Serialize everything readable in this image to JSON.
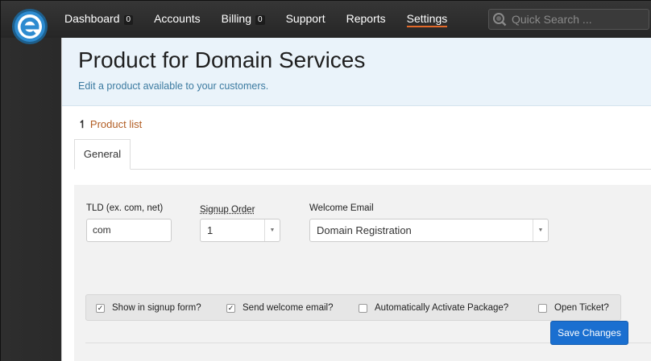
{
  "nav": {
    "items": [
      {
        "label": "Dashboard",
        "badge": "0"
      },
      {
        "label": "Accounts",
        "badge": null
      },
      {
        "label": "Billing",
        "badge": "0"
      },
      {
        "label": "Support",
        "badge": null
      },
      {
        "label": "Reports",
        "badge": null
      },
      {
        "label": "Settings",
        "badge": null,
        "active": true
      }
    ],
    "search_placeholder": "Quick Search ..."
  },
  "header": {
    "title": "Product for Domain Services",
    "subtitle": "Edit a product available to your customers."
  },
  "breadcrumb": {
    "label": "Product list"
  },
  "tabs": [
    {
      "label": "General",
      "active": true
    }
  ],
  "form": {
    "tld": {
      "label": "TLD (ex. com, net)",
      "value": "com"
    },
    "signup_order": {
      "label": "Signup Order",
      "value": "1"
    },
    "welcome_email": {
      "label": "Welcome Email",
      "value": "Domain Registration"
    },
    "checks": [
      {
        "label": "Show in signup form?",
        "checked": true
      },
      {
        "label": "Send welcome email?",
        "checked": true
      },
      {
        "label": "Automatically Activate Package?",
        "checked": false
      },
      {
        "label": "Open Ticket?",
        "checked": false
      }
    ],
    "save_label": "Save Changes"
  },
  "colors": {
    "accent_orange": "#e46a2a",
    "link": "#b25d23",
    "primary_button": "#1a6fd0",
    "header_bg": "#eaf3fa"
  }
}
